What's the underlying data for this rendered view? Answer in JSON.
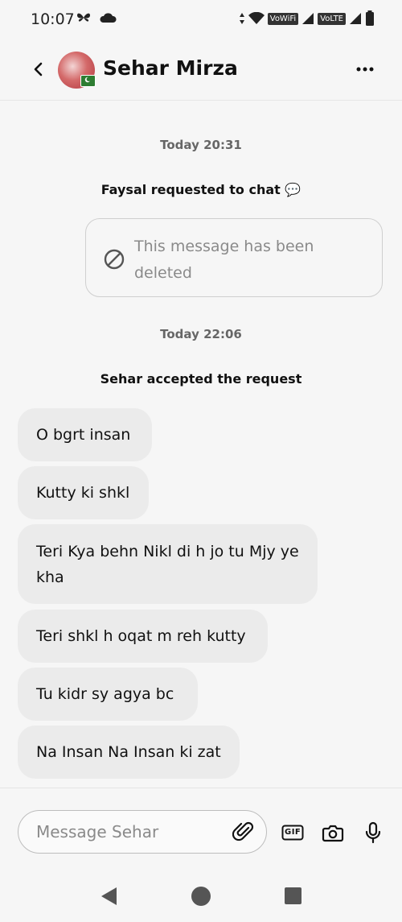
{
  "status_bar": {
    "time": "10:07",
    "vowifi": "VoWiFi",
    "volte": "VoLTE"
  },
  "header": {
    "contact_name": "Sehar Mirza"
  },
  "conversation": {
    "timestamp_1": "Today 20:31",
    "system_msg_1": "Faysal requested to chat 💬",
    "deleted_message": "This message has been deleted",
    "timestamp_2": "Today 22:06",
    "system_msg_2": "Sehar accepted the request",
    "messages": [
      "O bgrt insan",
      "Kutty ki shkl",
      "Teri Kya behn Nikl di h jo tu Mjy ye kha",
      "Teri shkl h oqat m reh kutty",
      "Tu kidr sy agya bc",
      "Na Insan Na Insan ki zat"
    ]
  },
  "composer": {
    "placeholder": "Message Sehar",
    "gif_label": "GIF"
  },
  "icons": {
    "back": "back-arrow-icon",
    "more": "more-options-icon",
    "deleted": "prohibited-icon",
    "attach": "paperclip-icon",
    "gif": "gif-icon",
    "camera": "camera-icon",
    "mic": "microphone-icon",
    "nav_back": "nav-back-icon",
    "nav_home": "nav-home-icon",
    "nav_recents": "nav-recents-icon"
  }
}
